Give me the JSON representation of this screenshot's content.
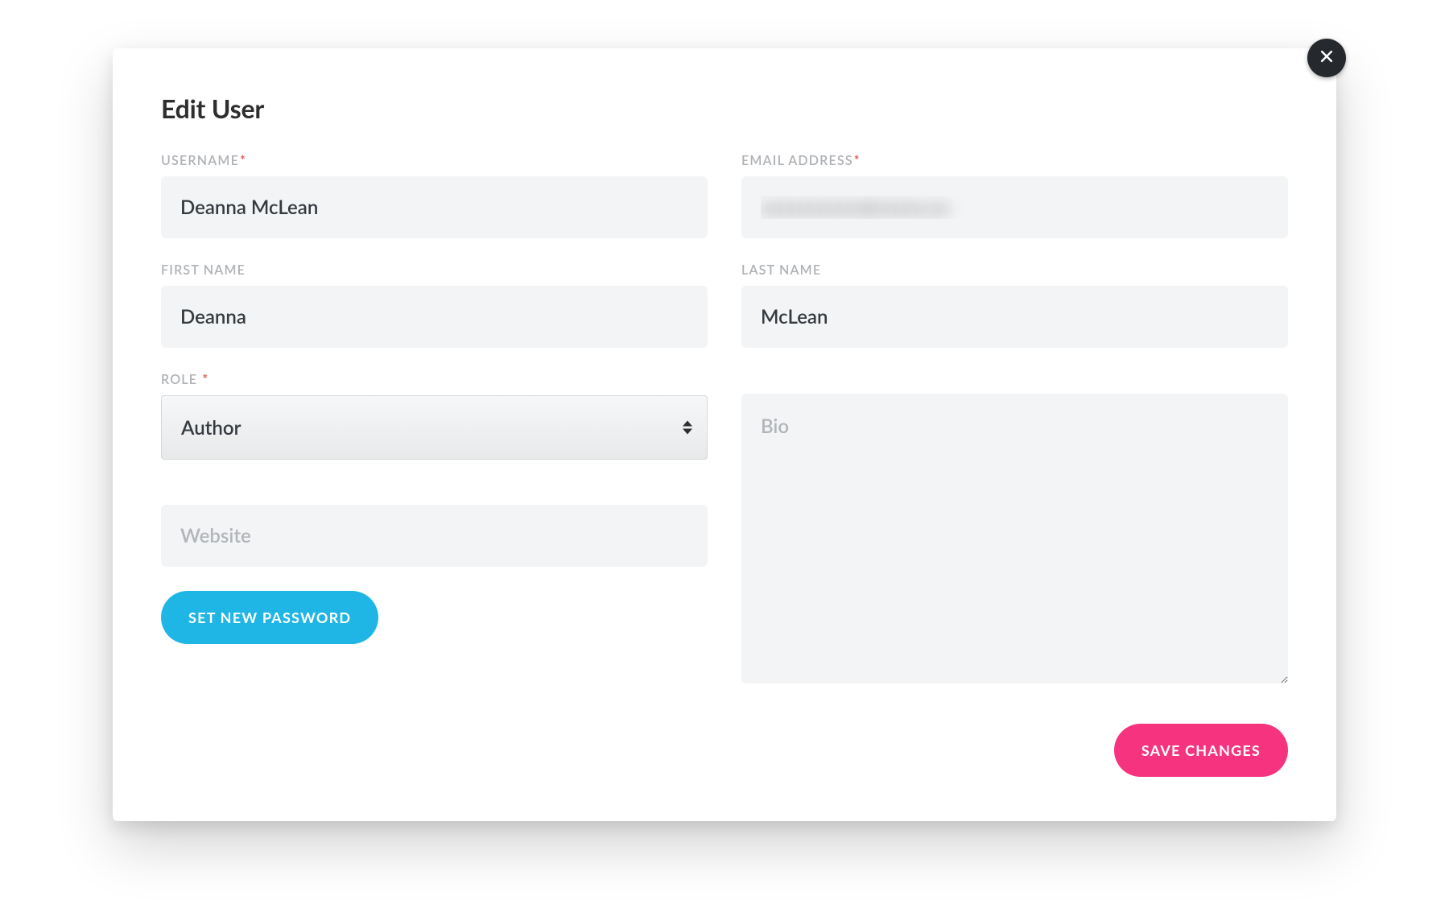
{
  "modal": {
    "title": "Edit User",
    "closeIcon": "close-icon"
  },
  "fields": {
    "username": {
      "label": "USERNAME",
      "required": "*",
      "value": "Deanna McLean"
    },
    "email": {
      "label": "EMAIL ADDRESS",
      "required": "*",
      "value": "xxxxxxxxxx@xxxxx.xx"
    },
    "firstName": {
      "label": "FIRST NAME",
      "value": "Deanna"
    },
    "lastName": {
      "label": "LAST NAME",
      "value": "McLean"
    },
    "role": {
      "label": "ROLE",
      "required": "*",
      "value": "Author"
    },
    "website": {
      "placeholder": "Website",
      "value": ""
    },
    "bio": {
      "placeholder": "Bio",
      "value": ""
    }
  },
  "buttons": {
    "setPassword": "SET NEW PASSWORD",
    "save": "SAVE CHANGES"
  },
  "colors": {
    "primaryBlue": "#1fb6e6",
    "accentPink": "#f5337f",
    "closeBg": "#25292d",
    "inputBg": "#f3f4f5",
    "labelGray": "#aeb1b5",
    "textDark": "#343a3f",
    "requiredRed": "#e64a4a"
  }
}
